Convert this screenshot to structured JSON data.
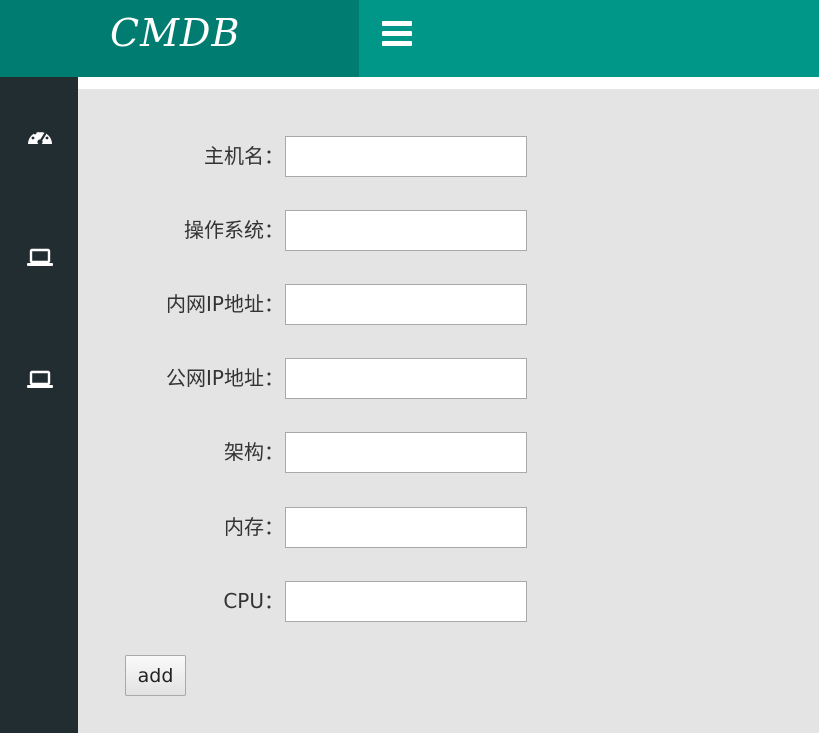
{
  "header": {
    "logo": "CMDB",
    "menu_icon": "bars-icon",
    "bg_color": "#009688",
    "logo_bg_color": "#007d70"
  },
  "sidebar": {
    "bg_color": "#222d32",
    "items": [
      {
        "icon": "dashboard-gauge-icon"
      },
      {
        "icon": "laptop-icon"
      },
      {
        "icon": "laptop-icon"
      }
    ]
  },
  "form": {
    "fields": [
      {
        "label": "主机名：",
        "value": "",
        "placeholder": ""
      },
      {
        "label": "操作系统：",
        "value": "",
        "placeholder": ""
      },
      {
        "label": "内网IP地址：",
        "value": "",
        "placeholder": ""
      },
      {
        "label": "公网IP地址：",
        "value": "",
        "placeholder": ""
      },
      {
        "label": "架构：",
        "value": "",
        "placeholder": ""
      },
      {
        "label": "内存：",
        "value": "",
        "placeholder": ""
      },
      {
        "label": "CPU：",
        "value": "",
        "placeholder": ""
      }
    ],
    "submit_label": "add"
  }
}
